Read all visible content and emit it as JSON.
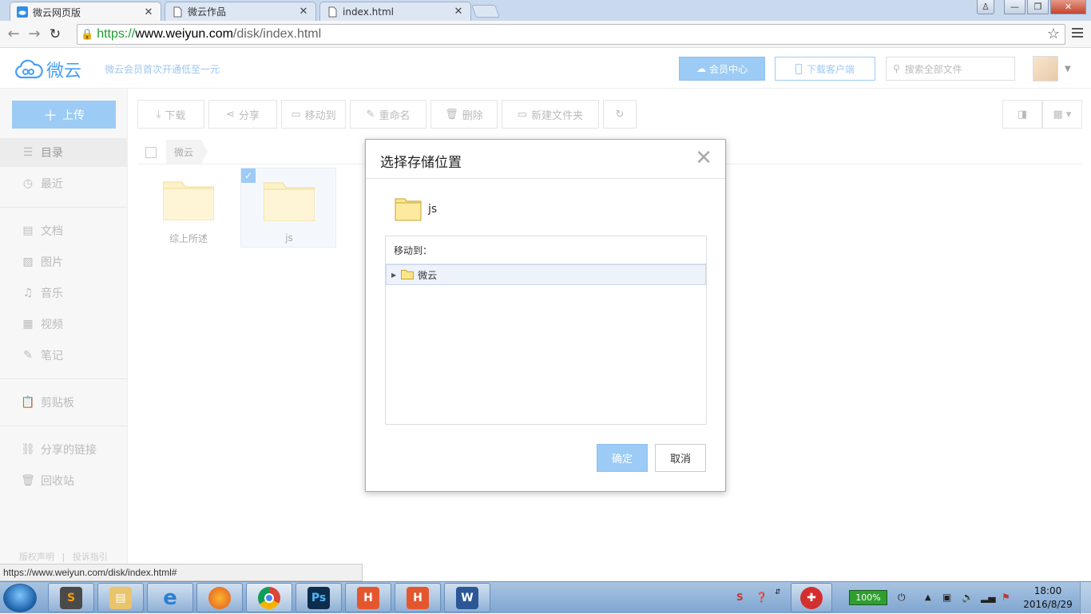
{
  "browser": {
    "tabs": [
      {
        "label": "微云网页版",
        "active": true
      },
      {
        "label": "微云作品",
        "active": false
      },
      {
        "label": "index.html",
        "active": false
      }
    ],
    "url": {
      "scheme": "https://",
      "domain": "www.weiyun.com",
      "path": "/disk/index.html"
    },
    "status_url": "https://www.weiyun.com/disk/index.html#"
  },
  "header": {
    "logo_text": "微云",
    "tagline": "微云会员首次开通低至一元",
    "vip_label": "会员中心",
    "download_client_label": "下载客户端",
    "search_placeholder": "搜索全部文件"
  },
  "sidebar": {
    "upload_label": "上传",
    "items": [
      {
        "label": "目录",
        "icon": "list-icon",
        "active": true
      },
      {
        "label": "最近",
        "icon": "clock-icon"
      },
      {
        "label": "文档",
        "icon": "document-icon"
      },
      {
        "label": "图片",
        "icon": "image-icon"
      },
      {
        "label": "音乐",
        "icon": "music-icon"
      },
      {
        "label": "视频",
        "icon": "film-icon"
      },
      {
        "label": "笔记",
        "icon": "note-icon"
      },
      {
        "label": "剪贴板",
        "icon": "clipboard-icon"
      },
      {
        "label": "分享的链接",
        "icon": "link-icon"
      },
      {
        "label": "回收站",
        "icon": "trash-icon"
      }
    ],
    "footer": [
      "版权声明",
      "投诉指引"
    ]
  },
  "toolbar": {
    "download": "下载",
    "share": "分享",
    "move_to": "移动到",
    "rename": "重命名",
    "delete": "删除",
    "new_folder": "新建文件夹"
  },
  "breadcrumb": {
    "root": "微云"
  },
  "files": [
    {
      "name": "综上所述",
      "selected": false
    },
    {
      "name": "js",
      "selected": true
    }
  ],
  "dialog": {
    "title": "选择存储位置",
    "file_name": "js",
    "move_to_label": "移动到：",
    "tree_root": "微云",
    "ok_label": "确定",
    "cancel_label": "取消"
  },
  "taskbar": {
    "battery": "100%",
    "time": "18:00",
    "date": "2016/8/29"
  },
  "colors": {
    "accent": "#9ccbf5",
    "brand": "#4a9ff5",
    "folder": "#fdf1c6"
  }
}
